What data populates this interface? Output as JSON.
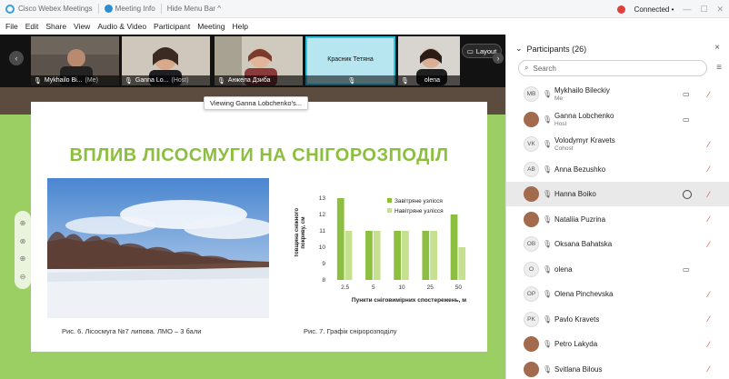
{
  "titlebar": {
    "app_name": "Cisco Webex Meetings",
    "meeting_info": "Meeting Info",
    "hide_menu": "Hide Menu Bar ^",
    "status": "Connected •",
    "minimize": "—",
    "maximize": "☐",
    "close": "✕"
  },
  "menubar": [
    "File",
    "Edit",
    "Share",
    "View",
    "Audio & Video",
    "Participant",
    "Meeting",
    "Help"
  ],
  "video_strip": {
    "tiles": [
      {
        "name": "Mykhailo Bi...",
        "extra": "(Me)"
      },
      {
        "name": "Ganna Lo...",
        "extra": "(Host)"
      },
      {
        "name": "Анжела Дзиба",
        "extra": ""
      },
      {
        "name": "",
        "extra": "",
        "center_text": "Красник Тетяна"
      },
      {
        "name": "olena",
        "extra": ""
      }
    ],
    "layout_label": "Layout",
    "prev_arrow": "‹",
    "next_arrow": "›"
  },
  "share": {
    "viewing_tooltip": "Viewing Ganna Lobchenko's...",
    "slide_title": "ВПЛИВ ЛІСОСМУГИ НА СНІГОРОЗПОДІЛ",
    "photo_caption": "Рис. 6. Лісосмуга №7 липова. ЛМО – 3 бали",
    "chart_caption": "Рис. 7. Графік  сніророзподілу",
    "zoom_icons": [
      "⊕",
      "⊗",
      "⊕",
      "⊖"
    ]
  },
  "chart_data": {
    "type": "bar",
    "categories": [
      "2.5",
      "5",
      "10",
      "25",
      "50"
    ],
    "series": [
      {
        "name": "Завітряне узлісся",
        "values": [
          13,
          11,
          11,
          11,
          12
        ],
        "color": "#8cbf3f"
      },
      {
        "name": "Навітряне узлісся",
        "values": [
          11,
          11,
          11,
          11,
          10
        ],
        "color": "#c5e08e"
      }
    ],
    "yticks": [
      "13",
      "12",
      "11",
      "10",
      "9",
      "8"
    ],
    "ylim": [
      8,
      13
    ],
    "xlabel": "Пункти сніговимірних спостережень, м",
    "ylabel": "Товщина сніжного покриву, см",
    "legend_position": "top-right",
    "grid": false
  },
  "participants": {
    "title": "Participants (26)",
    "close": "×",
    "search_placeholder": "Search",
    "list": [
      {
        "initials": "MB",
        "name": "Mykhailo Bileckiy",
        "role": "Me",
        "video": "▭",
        "muted": true
      },
      {
        "initials": "",
        "name": "Ganna Lobchenko",
        "role": "Host",
        "video": "▭",
        "muted": false,
        "photo": true
      },
      {
        "initials": "VK",
        "name": "Volodymyr Kravets",
        "role": "Cohost",
        "video": "",
        "muted": true
      },
      {
        "initials": "AB",
        "name": "Anna Bezushko",
        "role": "",
        "video": "",
        "muted": true
      },
      {
        "initials": "",
        "name": "Hanna Boiko",
        "role": "",
        "video": "",
        "muted": true,
        "photo": true,
        "highlight": true,
        "chat": true
      },
      {
        "initials": "",
        "name": "Nataliia Puzrina",
        "role": "",
        "video": "",
        "muted": true,
        "photo": true
      },
      {
        "initials": "OB",
        "name": "Oksana Bahatska",
        "role": "",
        "video": "",
        "muted": true
      },
      {
        "initials": "O",
        "name": "olena",
        "role": "",
        "video": "▭",
        "muted": false
      },
      {
        "initials": "OP",
        "name": "Olena Pinchevska",
        "role": "",
        "video": "",
        "muted": true
      },
      {
        "initials": "PK",
        "name": "Pavlo Kravets",
        "role": "",
        "video": "",
        "muted": true
      },
      {
        "initials": "",
        "name": "Petro Lakyda",
        "role": "",
        "video": "",
        "muted": true,
        "photo": true
      },
      {
        "initials": "",
        "name": "Svitlana Bilous",
        "role": "",
        "video": "",
        "muted": true,
        "photo": true
      }
    ]
  }
}
